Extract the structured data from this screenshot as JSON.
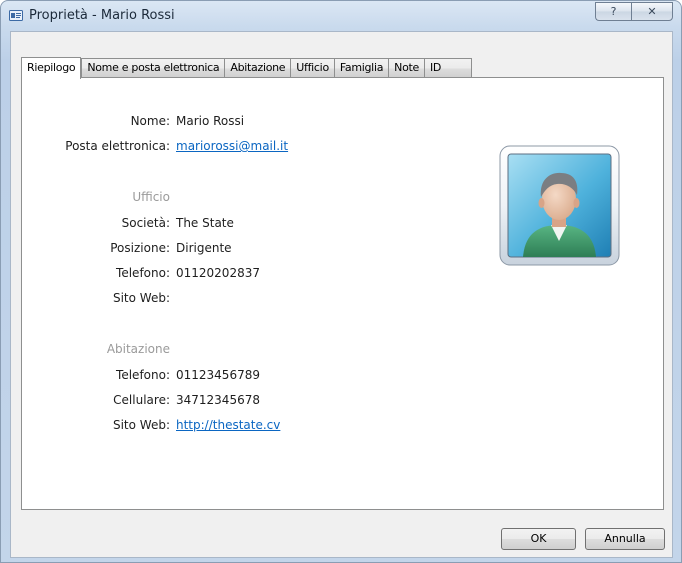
{
  "window": {
    "title": "Proprietà - Mario Rossi",
    "help_glyph": "?",
    "close_glyph": "✕"
  },
  "tabs": [
    {
      "label": "Riepilogo",
      "active": true
    },
    {
      "label": "Nome e posta elettronica",
      "active": false
    },
    {
      "label": "Abitazione",
      "active": false
    },
    {
      "label": "Ufficio",
      "active": false
    },
    {
      "label": "Famiglia",
      "active": false
    },
    {
      "label": "Note",
      "active": false
    },
    {
      "label": "ID",
      "active": false
    }
  ],
  "summary": {
    "name_label": "Nome:",
    "name_value": "Mario Rossi",
    "email_label": "Posta elettronica:",
    "email_value": "mariorossi@mail.it",
    "office_section": "Ufficio",
    "company_label": "Società:",
    "company_value": "The State",
    "position_label": "Posizione:",
    "position_value": "Dirigente",
    "office_phone_label": "Telefono:",
    "office_phone_value": "01120202837",
    "office_website_label": "Sito Web:",
    "office_website_value": "",
    "home_section": "Abitazione",
    "home_phone_label": "Telefono:",
    "home_phone_value": "01123456789",
    "mobile_label": "Cellulare:",
    "mobile_value": "34712345678",
    "home_website_label": "Sito Web:",
    "home_website_value": "http://thestate.cv"
  },
  "buttons": {
    "ok": "OK",
    "cancel": "Annulla"
  },
  "colors": {
    "link": "#0b66c2",
    "section_label": "#9a9a9a",
    "avatar_shirt": "#3f9a6a"
  }
}
